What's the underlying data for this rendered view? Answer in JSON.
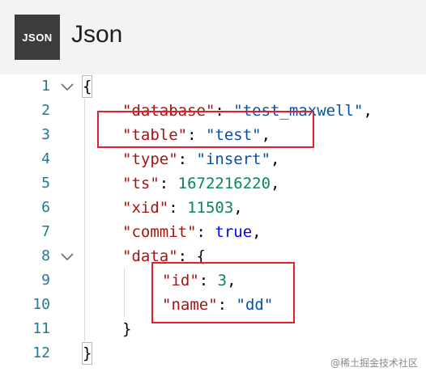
{
  "header": {
    "logo_text": "JSON",
    "title": "Json"
  },
  "editor": {
    "lines": [
      {
        "num": "1",
        "parts": [
          {
            "t": "{",
            "c": "punct"
          }
        ]
      },
      {
        "num": "2",
        "parts": [
          {
            "t": "\"database\"",
            "c": "key"
          },
          {
            "t": ": ",
            "c": "punct"
          },
          {
            "t": "\"test_maxwell\"",
            "c": "str"
          },
          {
            "t": ",",
            "c": "punct"
          }
        ]
      },
      {
        "num": "3",
        "parts": [
          {
            "t": "\"table\"",
            "c": "key"
          },
          {
            "t": ": ",
            "c": "punct"
          },
          {
            "t": "\"test\"",
            "c": "str"
          },
          {
            "t": ",",
            "c": "punct"
          }
        ]
      },
      {
        "num": "4",
        "parts": [
          {
            "t": "\"type\"",
            "c": "key"
          },
          {
            "t": ": ",
            "c": "punct"
          },
          {
            "t": "\"insert\"",
            "c": "str"
          },
          {
            "t": ",",
            "c": "punct"
          }
        ]
      },
      {
        "num": "5",
        "parts": [
          {
            "t": "\"ts\"",
            "c": "key"
          },
          {
            "t": ": ",
            "c": "punct"
          },
          {
            "t": "1672216220",
            "c": "num"
          },
          {
            "t": ",",
            "c": "punct"
          }
        ]
      },
      {
        "num": "6",
        "parts": [
          {
            "t": "\"xid\"",
            "c": "key"
          },
          {
            "t": ": ",
            "c": "punct"
          },
          {
            "t": "11503",
            "c": "num"
          },
          {
            "t": ",",
            "c": "punct"
          }
        ]
      },
      {
        "num": "7",
        "parts": [
          {
            "t": "\"commit\"",
            "c": "key"
          },
          {
            "t": ": ",
            "c": "punct"
          },
          {
            "t": "true",
            "c": "kw"
          },
          {
            "t": ",",
            "c": "punct"
          }
        ]
      },
      {
        "num": "8",
        "parts": [
          {
            "t": "\"data\"",
            "c": "key"
          },
          {
            "t": ": {",
            "c": "punct"
          }
        ]
      },
      {
        "num": "9",
        "parts": [
          {
            "t": "\"id\"",
            "c": "key"
          },
          {
            "t": ": ",
            "c": "punct"
          },
          {
            "t": "3",
            "c": "num"
          },
          {
            "t": ",",
            "c": "punct"
          }
        ]
      },
      {
        "num": "10",
        "parts": [
          {
            "t": "\"name\"",
            "c": "key"
          },
          {
            "t": ": ",
            "c": "punct"
          },
          {
            "t": "\"dd\"",
            "c": "str"
          }
        ]
      },
      {
        "num": "11",
        "parts": [
          {
            "t": "}",
            "c": "punct"
          }
        ]
      },
      {
        "num": "12",
        "parts": [
          {
            "t": "}",
            "c": "punct"
          }
        ]
      }
    ]
  },
  "watermark": "@稀土掘金技术社区",
  "colors": {
    "line_number": "#237893",
    "key": "#a31515",
    "string": "#0451a5",
    "number": "#098658",
    "keyword": "#0000ff",
    "highlight_box": "#e0202a"
  }
}
